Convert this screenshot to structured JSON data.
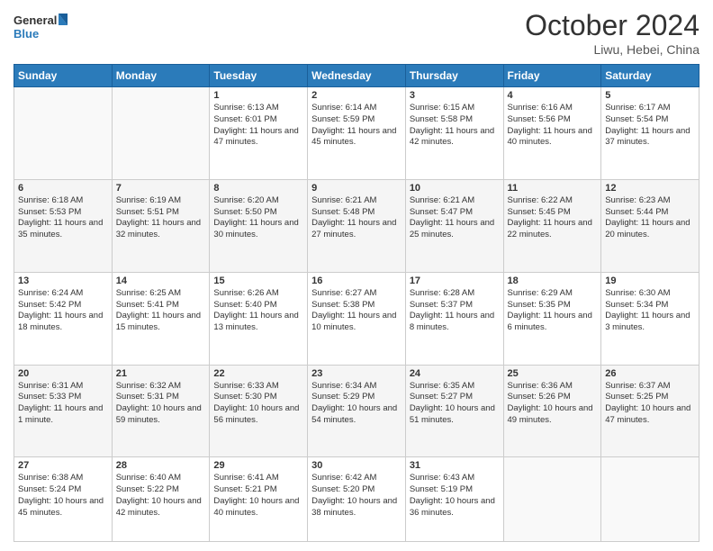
{
  "header": {
    "logo_line1": "General",
    "logo_line2": "Blue",
    "month_title": "October 2024",
    "location": "Liwu, Hebei, China"
  },
  "weekdays": [
    "Sunday",
    "Monday",
    "Tuesday",
    "Wednesday",
    "Thursday",
    "Friday",
    "Saturday"
  ],
  "weeks": [
    [
      {
        "day": "",
        "text": ""
      },
      {
        "day": "",
        "text": ""
      },
      {
        "day": "1",
        "text": "Sunrise: 6:13 AM\nSunset: 6:01 PM\nDaylight: 11 hours and 47 minutes."
      },
      {
        "day": "2",
        "text": "Sunrise: 6:14 AM\nSunset: 5:59 PM\nDaylight: 11 hours and 45 minutes."
      },
      {
        "day": "3",
        "text": "Sunrise: 6:15 AM\nSunset: 5:58 PM\nDaylight: 11 hours and 42 minutes."
      },
      {
        "day": "4",
        "text": "Sunrise: 6:16 AM\nSunset: 5:56 PM\nDaylight: 11 hours and 40 minutes."
      },
      {
        "day": "5",
        "text": "Sunrise: 6:17 AM\nSunset: 5:54 PM\nDaylight: 11 hours and 37 minutes."
      }
    ],
    [
      {
        "day": "6",
        "text": "Sunrise: 6:18 AM\nSunset: 5:53 PM\nDaylight: 11 hours and 35 minutes."
      },
      {
        "day": "7",
        "text": "Sunrise: 6:19 AM\nSunset: 5:51 PM\nDaylight: 11 hours and 32 minutes."
      },
      {
        "day": "8",
        "text": "Sunrise: 6:20 AM\nSunset: 5:50 PM\nDaylight: 11 hours and 30 minutes."
      },
      {
        "day": "9",
        "text": "Sunrise: 6:21 AM\nSunset: 5:48 PM\nDaylight: 11 hours and 27 minutes."
      },
      {
        "day": "10",
        "text": "Sunrise: 6:21 AM\nSunset: 5:47 PM\nDaylight: 11 hours and 25 minutes."
      },
      {
        "day": "11",
        "text": "Sunrise: 6:22 AM\nSunset: 5:45 PM\nDaylight: 11 hours and 22 minutes."
      },
      {
        "day": "12",
        "text": "Sunrise: 6:23 AM\nSunset: 5:44 PM\nDaylight: 11 hours and 20 minutes."
      }
    ],
    [
      {
        "day": "13",
        "text": "Sunrise: 6:24 AM\nSunset: 5:42 PM\nDaylight: 11 hours and 18 minutes."
      },
      {
        "day": "14",
        "text": "Sunrise: 6:25 AM\nSunset: 5:41 PM\nDaylight: 11 hours and 15 minutes."
      },
      {
        "day": "15",
        "text": "Sunrise: 6:26 AM\nSunset: 5:40 PM\nDaylight: 11 hours and 13 minutes."
      },
      {
        "day": "16",
        "text": "Sunrise: 6:27 AM\nSunset: 5:38 PM\nDaylight: 11 hours and 10 minutes."
      },
      {
        "day": "17",
        "text": "Sunrise: 6:28 AM\nSunset: 5:37 PM\nDaylight: 11 hours and 8 minutes."
      },
      {
        "day": "18",
        "text": "Sunrise: 6:29 AM\nSunset: 5:35 PM\nDaylight: 11 hours and 6 minutes."
      },
      {
        "day": "19",
        "text": "Sunrise: 6:30 AM\nSunset: 5:34 PM\nDaylight: 11 hours and 3 minutes."
      }
    ],
    [
      {
        "day": "20",
        "text": "Sunrise: 6:31 AM\nSunset: 5:33 PM\nDaylight: 11 hours and 1 minute."
      },
      {
        "day": "21",
        "text": "Sunrise: 6:32 AM\nSunset: 5:31 PM\nDaylight: 10 hours and 59 minutes."
      },
      {
        "day": "22",
        "text": "Sunrise: 6:33 AM\nSunset: 5:30 PM\nDaylight: 10 hours and 56 minutes."
      },
      {
        "day": "23",
        "text": "Sunrise: 6:34 AM\nSunset: 5:29 PM\nDaylight: 10 hours and 54 minutes."
      },
      {
        "day": "24",
        "text": "Sunrise: 6:35 AM\nSunset: 5:27 PM\nDaylight: 10 hours and 51 minutes."
      },
      {
        "day": "25",
        "text": "Sunrise: 6:36 AM\nSunset: 5:26 PM\nDaylight: 10 hours and 49 minutes."
      },
      {
        "day": "26",
        "text": "Sunrise: 6:37 AM\nSunset: 5:25 PM\nDaylight: 10 hours and 47 minutes."
      }
    ],
    [
      {
        "day": "27",
        "text": "Sunrise: 6:38 AM\nSunset: 5:24 PM\nDaylight: 10 hours and 45 minutes."
      },
      {
        "day": "28",
        "text": "Sunrise: 6:40 AM\nSunset: 5:22 PM\nDaylight: 10 hours and 42 minutes."
      },
      {
        "day": "29",
        "text": "Sunrise: 6:41 AM\nSunset: 5:21 PM\nDaylight: 10 hours and 40 minutes."
      },
      {
        "day": "30",
        "text": "Sunrise: 6:42 AM\nSunset: 5:20 PM\nDaylight: 10 hours and 38 minutes."
      },
      {
        "day": "31",
        "text": "Sunrise: 6:43 AM\nSunset: 5:19 PM\nDaylight: 10 hours and 36 minutes."
      },
      {
        "day": "",
        "text": ""
      },
      {
        "day": "",
        "text": ""
      }
    ]
  ]
}
